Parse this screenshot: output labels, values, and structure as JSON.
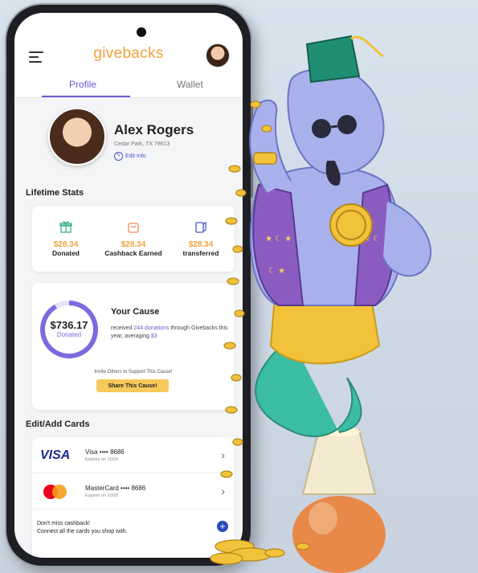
{
  "app": {
    "brand": "givebacks"
  },
  "tabs": [
    {
      "label": "Profile"
    },
    {
      "label": "Wallet"
    }
  ],
  "profile": {
    "name": "Alex Rogers",
    "location": "Cedar Park, TX 78613",
    "edit_label": "Edit Info"
  },
  "lifetime_stats": {
    "title": "Lifetime Stats",
    "items": [
      {
        "value": "$28.34",
        "label": "Donated",
        "icon": "gift-icon"
      },
      {
        "value": "$28.34",
        "label": "Cashback Earned",
        "icon": "shopping-bag-icon"
      },
      {
        "value": "$28.34",
        "label": "transferred",
        "icon": "transfer-icon"
      }
    ]
  },
  "cause": {
    "amount": "$736.17",
    "amount_label": "Donated",
    "title": "Your Cause",
    "text_pre": "received ",
    "donations": "244 donations",
    "text_mid": " through Givebacks this year, averaging ",
    "average": "$3",
    "invite": "Invite Others to Support This Cause!",
    "share_label": "Share This Cause!"
  },
  "cards_section": {
    "title": "Edit/Add Cards",
    "cards": [
      {
        "brand_logo": "VISA",
        "name": "Visa •••• 8686",
        "expires": "Expires on 10/26"
      },
      {
        "brand_logo": "mastercard-logo",
        "name": "MasterCard •••• 8686",
        "expires": "Expires on 10/26"
      }
    ],
    "cashback_line1": "Don't miss cashback!",
    "cashback_line2": "Connect all the cards you shop with."
  },
  "colors": {
    "brand": "#f0a23b",
    "accent": "#6a5bd0",
    "button": "#f6c95a",
    "visa": "#1a2a8c",
    "add_button": "#2b4bb8"
  }
}
